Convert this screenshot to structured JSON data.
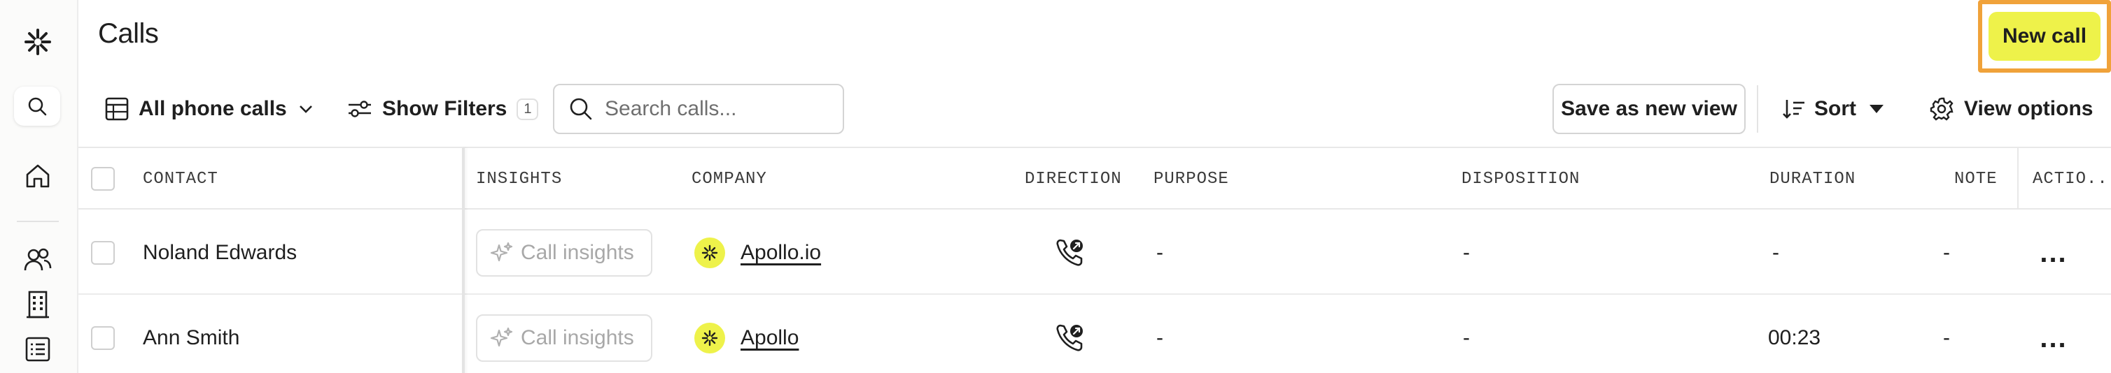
{
  "sidebar": {
    "icons": [
      "logo-icon",
      "search-icon",
      "home-icon",
      "people-icon",
      "building-icon",
      "list-icon"
    ]
  },
  "header": {
    "title": "Calls",
    "new_call_label": "New call"
  },
  "toolbar": {
    "view_label": "All phone calls",
    "filters_label": "Show Filters",
    "filters_count": "1",
    "search_placeholder": "Search calls...",
    "save_view_label": "Save as new view",
    "sort_label": "Sort",
    "view_options_label": "View options"
  },
  "table": {
    "columns": [
      "CONTACT",
      "INSIGHTS",
      "COMPANY",
      "DIRECTION",
      "PURPOSE",
      "DISPOSITION",
      "DURATION",
      "NOTE",
      "ACTIO..."
    ],
    "rows": [
      {
        "contact": "Noland Edwards",
        "insights": "Call insights",
        "company": "Apollo.io",
        "direction_icon": "outbound-call-icon",
        "purpose": "-",
        "disposition": "-",
        "duration": "-",
        "note": "-",
        "actions": "..."
      },
      {
        "contact": "Ann Smith",
        "insights": "Call insights",
        "company": "Apollo",
        "direction_icon": "outbound-call-icon",
        "purpose": "-",
        "disposition": "-",
        "duration": "00:23",
        "note": "-",
        "actions": "..."
      }
    ]
  },
  "colors": {
    "accent": "#eef24a",
    "highlight_border": "#f0a23a"
  }
}
